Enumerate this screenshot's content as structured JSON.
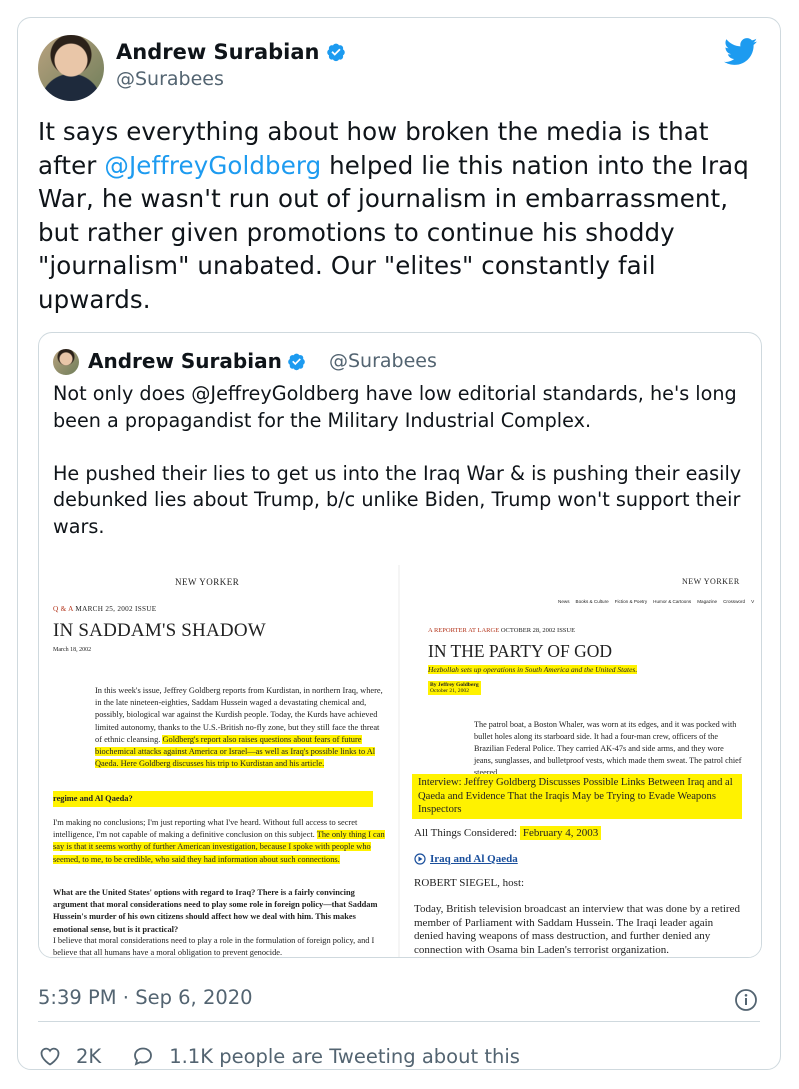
{
  "author": {
    "name": "Andrew Surabian",
    "handle": "@Surabees"
  },
  "tweet": {
    "parts": [
      "It says everything about how broken the media is that after ",
      "@JeffreyGoldberg",
      " helped lie this nation into the Iraq War, he wasn't run out of journalism in embarrassment, but rather given promotions to continue his shoddy \"journalism\" unabated. Our \"elites\" constantly fail upwards."
    ]
  },
  "quote": {
    "name": "Andrew Surabian",
    "handle": "@Surabees",
    "paragraph1": "Not only does @JeffreyGoldberg have low editorial standards, he's long been a propagandist for the Military Industrial Complex.",
    "paragraph2": "He pushed their lies to get us into the Iraq War & is pushing their easily debunked lies about Trump, b/c unlike Biden, Trump won't support their wars."
  },
  "media_left": {
    "logo": "NEW YORKER",
    "kicker": "Q & A",
    "issue": "MARCH 25, 2002 ISSUE",
    "headline": "IN SADDAM'S SHADOW",
    "date": "March 18, 2002",
    "para1": "In this week's issue, Jeffrey Goldberg reports from Kurdistan, in northern Iraq, where, in the late nineteen-eighties, Saddam Hussein waged a devastating chemical and, possibly, biological war against the Kurdish people. Today, the Kurds have achieved limited autonomy, thanks to the U.S.-British no-fly zone, but they still face the threat of ethnic cleansing.",
    "para1_hl": "Goldberg's report also raises questions about fears of future biochemical attacks against America or Israel—as well as Iraq's possible links to Al Qaeda. Here Goldberg discusses his trip to Kurdistan and his article.",
    "q_fragment": "regime and Al Qaeda?",
    "answer1": "I'm making no conclusions; I'm just reporting what I've heard. Without full access to secret intelligence, I'm not capable of making a definitive conclusion on this subject.",
    "answer1_hl": "The only thing I can say is that it seems worthy of further American investigation, because I spoke with people who seemed, to me, to be credible, who said they had information about such connections.",
    "question2": "What are the United States' options with regard to Iraq? There is a fairly convincing argument that moral considerations need to play some role in foreign policy—that Saddam Hussein's murder of his own citizens should affect how we deal with him. This makes emotional sense, but is it practical?",
    "answer2": "I believe that moral considerations need to play a role in the formulation of foreign policy, and I believe that all humans have a moral obligation to prevent genocide."
  },
  "media_right": {
    "logo": "NEW YORKER",
    "nav": [
      "News",
      "Books & Culture",
      "Fiction & Poetry",
      "Humor & Cartoons",
      "Magazine",
      "Crossword",
      "V"
    ],
    "kicker": "A REPORTER AT LARGE",
    "issue": "OCTOBER 28, 2002 ISSUE",
    "headline": "IN THE PARTY OF GOD",
    "dek": "Hezbollah sets up operations in South America and the United States.",
    "byline": "By Jeffrey Goldberg",
    "byline_date": "October 21, 2002",
    "body": "The patrol boat, a Boston Whaler, was worn at its edges, and it was pocked with bullet holes along its starboard side. It had a four-man crew, officers of the Brazilian Federal Police. They carried AK-47s and side arms, and they wore jeans, sunglasses, and bulletproof vests, which made them sweat. The patrol chief steered",
    "interview_title": "Interview: Jeffrey Goldberg Discusses Possible Links Between Iraq and al Qaeda and Evidence That the Iraqis May be Trying to Evade Weapons Inspectors",
    "show": "All Things Considered:",
    "show_date": "February 4, 2003",
    "audio_link": "Iraq and Al Qaeda",
    "host": "ROBERT SIEGEL, host:",
    "transcript": "Today, British television broadcast an interview that was done by a retired member of Parliament with Saddam Hussein. The Iraqi leader again denied having weapons of mass destruction, and further denied any connection with Osama bin Laden's terrorist organization."
  },
  "meta": {
    "time": "5:39 PM",
    "sep": "·",
    "date": "Sep 6, 2020"
  },
  "actions": {
    "likes": "2K",
    "retweets_text": "1.1K people are Tweeting about this"
  },
  "colors": {
    "link": "#1d9bf0",
    "secondary": "#536471",
    "highlight": "#fff200",
    "border": "#cfd9de"
  }
}
